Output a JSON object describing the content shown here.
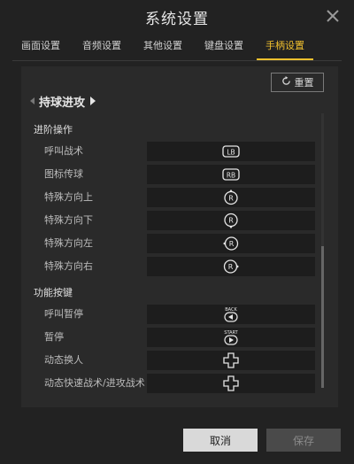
{
  "window": {
    "title": "系统设置"
  },
  "tabs": [
    {
      "label": "画面设置",
      "active": false
    },
    {
      "label": "音频设置",
      "active": false
    },
    {
      "label": "其他设置",
      "active": false
    },
    {
      "label": "键盘设置",
      "active": false
    },
    {
      "label": "手柄设置",
      "active": true
    }
  ],
  "reset_label": "重置",
  "section": {
    "label": "持球进攻"
  },
  "groups": [
    {
      "title": "进阶操作",
      "rows": [
        {
          "label": "呼叫战术",
          "key_icon": "lb-button-icon",
          "key_text": "LB"
        },
        {
          "label": "图标传球",
          "key_icon": "rb-button-icon",
          "key_text": "RB"
        },
        {
          "label": "特殊方向上",
          "key_icon": "right-stick-up-icon",
          "key_text": "R"
        },
        {
          "label": "特殊方向下",
          "key_icon": "right-stick-down-icon",
          "key_text": "R"
        },
        {
          "label": "特殊方向左",
          "key_icon": "right-stick-left-icon",
          "key_text": "R"
        },
        {
          "label": "特殊方向右",
          "key_icon": "right-stick-right-icon",
          "key_text": "R"
        }
      ]
    },
    {
      "title": "功能按键",
      "rows": [
        {
          "label": "呼叫暂停",
          "key_icon": "back-button-icon",
          "key_text": "BACK"
        },
        {
          "label": "暂停",
          "key_icon": "start-button-icon",
          "key_text": "START"
        },
        {
          "label": "动态换人",
          "key_icon": "dpad-icon"
        },
        {
          "label": "动态快速战术/进攻战术",
          "key_icon": "dpad-icon"
        }
      ]
    }
  ],
  "buttons": {
    "cancel": "取消",
    "save": "保存"
  },
  "colors": {
    "accent": "#f2c12e",
    "background": "#222222",
    "panel": "#2a2a2a"
  }
}
